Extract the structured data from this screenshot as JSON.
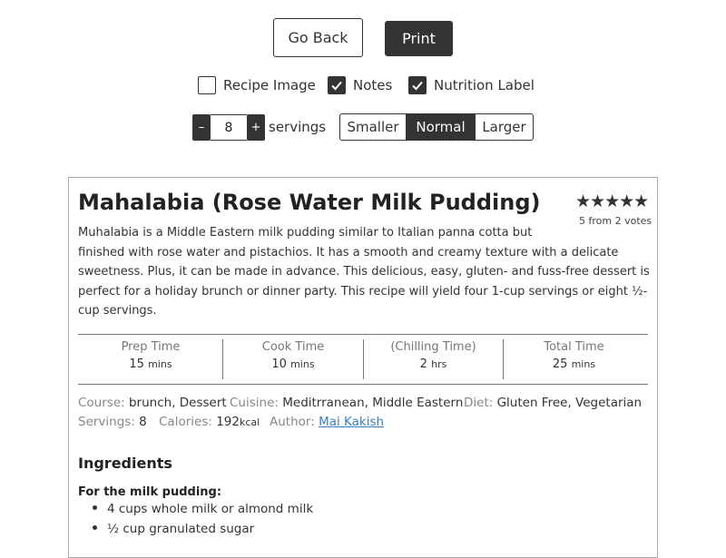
{
  "actions": {
    "back_label": "Go Back",
    "print_label": "Print"
  },
  "options": [
    {
      "label": "Recipe Image",
      "checked": false
    },
    {
      "label": "Notes",
      "checked": true
    },
    {
      "label": "Nutrition Label",
      "checked": true
    }
  ],
  "servings_control": {
    "minus": "–",
    "value": "8",
    "plus": "+",
    "label": "servings"
  },
  "size_options": [
    "Smaller",
    "Normal",
    "Larger"
  ],
  "size_selected": "Normal",
  "recipe": {
    "title": "Mahalabia (Rose Water Milk Pudding)",
    "stars": "★★★★★",
    "rating_value": 5,
    "rating_text": "5 from 2 votes",
    "summary_lines": [
      "Muhalabia is a Middle Eastern milk pudding similar to Italian panna cotta but",
      "finished with rose water and pistachios. It has a smooth and creamy texture with a delicate",
      "sweetness. Plus, it can be made in advance. This delicious, easy, gluten- and fuss-free dessert is",
      "perfect for a holiday brunch or dinner party. This recipe will yield four 1-cup servings or eight ½-",
      "cup servings."
    ],
    "times": [
      {
        "label": "Prep Time",
        "value": "15",
        "unit": "mins"
      },
      {
        "label": "Cook Time",
        "value": "10",
        "unit": "mins"
      },
      {
        "label": "(Chilling Time)",
        "value": "2",
        "unit": "hrs"
      },
      {
        "label": "Total Time",
        "value": "25",
        "unit": "mins"
      }
    ],
    "meta": {
      "course_label": "Course:",
      "course": "brunch, Dessert",
      "cuisine_label": "Cuisine:",
      "cuisine": "Meditrranean, Middle Eastern",
      "diet_label": "Diet:",
      "diet": "Gluten Free, Vegetarian",
      "servings_label": "Servings:",
      "servings": "8",
      "calories_label": "Calories:",
      "calories": "192",
      "calories_unit": "kcal",
      "author_label": "Author:",
      "author": "Mai Kakish"
    },
    "ingredients_heading": "Ingredients",
    "ingredient_group": "For the milk pudding:",
    "ingredients": [
      "4 cups whole milk or almond milk",
      "½ cup granulated sugar"
    ]
  },
  "colors": {
    "dark": "#333333",
    "link": "#3a7fbd",
    "muted": "#888888"
  }
}
